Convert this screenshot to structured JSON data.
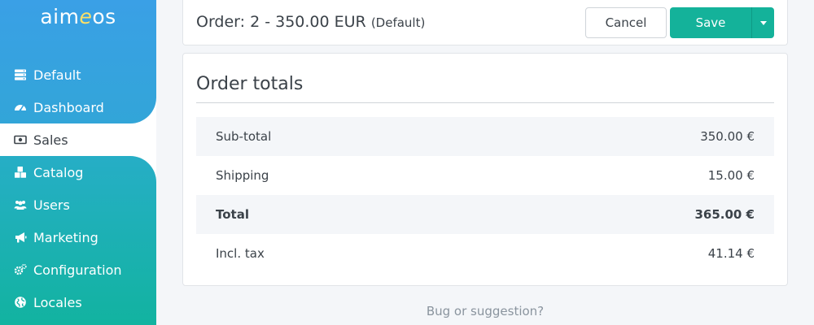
{
  "sidebar": {
    "logo_prefix": "aim",
    "logo_e": "e",
    "logo_suffix": "os",
    "items": [
      {
        "label": "Default",
        "icon": "server-icon"
      },
      {
        "label": "Dashboard",
        "icon": "gauge-icon"
      },
      {
        "label": "Sales",
        "icon": "money-bill-icon",
        "active": true
      },
      {
        "label": "Catalog",
        "icon": "cubes-icon"
      },
      {
        "label": "Users",
        "icon": "users-icon"
      },
      {
        "label": "Marketing",
        "icon": "bullhorn-icon"
      },
      {
        "label": "Configuration",
        "icon": "cogs-icon"
      },
      {
        "label": "Locales",
        "icon": "globe-icon"
      }
    ]
  },
  "header": {
    "title": "Order: 2 - 350.00 EUR",
    "site": "(Default)",
    "cancel_label": "Cancel",
    "save_label": "Save"
  },
  "totals": {
    "title": "Order totals",
    "rows": [
      {
        "label": "Sub-total",
        "value": "350.00 €"
      },
      {
        "label": "Shipping",
        "value": "15.00 €"
      },
      {
        "label": "Total",
        "value": "365.00 €"
      },
      {
        "label": "Incl. tax",
        "value": "41.14 €"
      }
    ]
  },
  "footer": {
    "bug_link": "Bug or suggestion?"
  },
  "colors": {
    "sidebar_top": "#3aa0e6",
    "sidebar_bottom": "#12b3a0",
    "save_button": "#14b29a",
    "text": "#3b4249",
    "muted": "#8a949e"
  }
}
